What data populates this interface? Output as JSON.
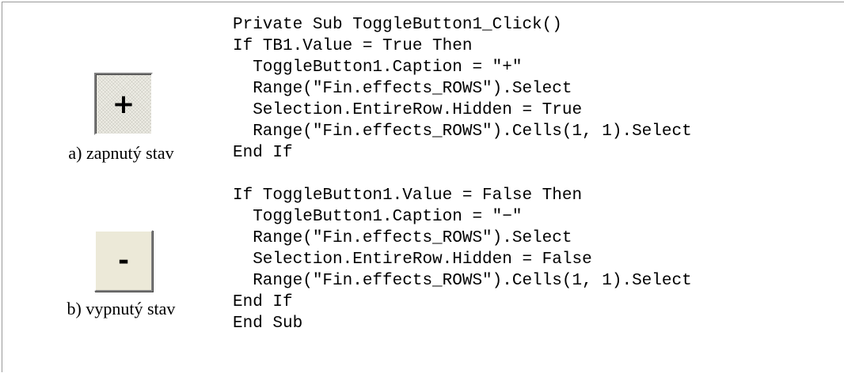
{
  "toggle_on": {
    "caption_symbol": "+",
    "label": "a) zapnutý stav"
  },
  "toggle_off": {
    "caption_symbol": "-",
    "label": "b) vypnutý stav"
  },
  "code_lines": [
    "Private Sub ToggleButton1_Click()",
    "If TB1.Value = True Then",
    "  ToggleButton1.Caption = \"+\"",
    "  Range(\"Fin.effects_ROWS\").Select",
    "  Selection.EntireRow.Hidden = True",
    "  Range(\"Fin.effects_ROWS\").Cells(1, 1).Select",
    "End If",
    "",
    "If ToggleButton1.Value = False Then",
    "  ToggleButton1.Caption = \"−\"",
    "  Range(\"Fin.effects_ROWS\").Select",
    "  Selection.EntireRow.Hidden = False",
    "  Range(\"Fin.effects_ROWS\").Cells(1, 1).Select",
    "End If",
    "End Sub"
  ]
}
